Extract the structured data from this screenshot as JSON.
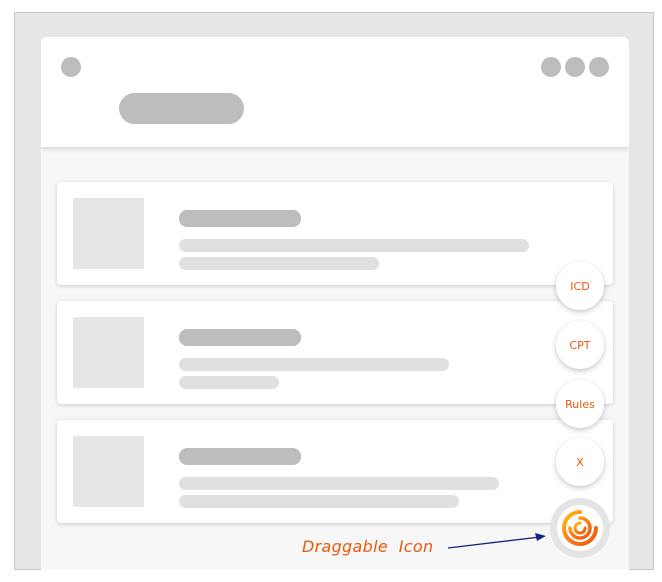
{
  "fab_menu": {
    "icd_label": "ICD",
    "cpt_label": "CPT",
    "rules_label": "Rules",
    "close_label": "X"
  },
  "annotation": {
    "text": "Draggable  Icon"
  },
  "colors": {
    "accent": "#e8590c",
    "arrow": "#1a237e",
    "placeholder_dark": "#bdbdbd",
    "placeholder_light": "#e0e0e0",
    "frame_bg": "#e6e6e6"
  },
  "icons": {
    "drag_handle": "swirl-logo-icon",
    "menu": "overflow-dots-icon",
    "nav": "nav-dot-icon"
  }
}
